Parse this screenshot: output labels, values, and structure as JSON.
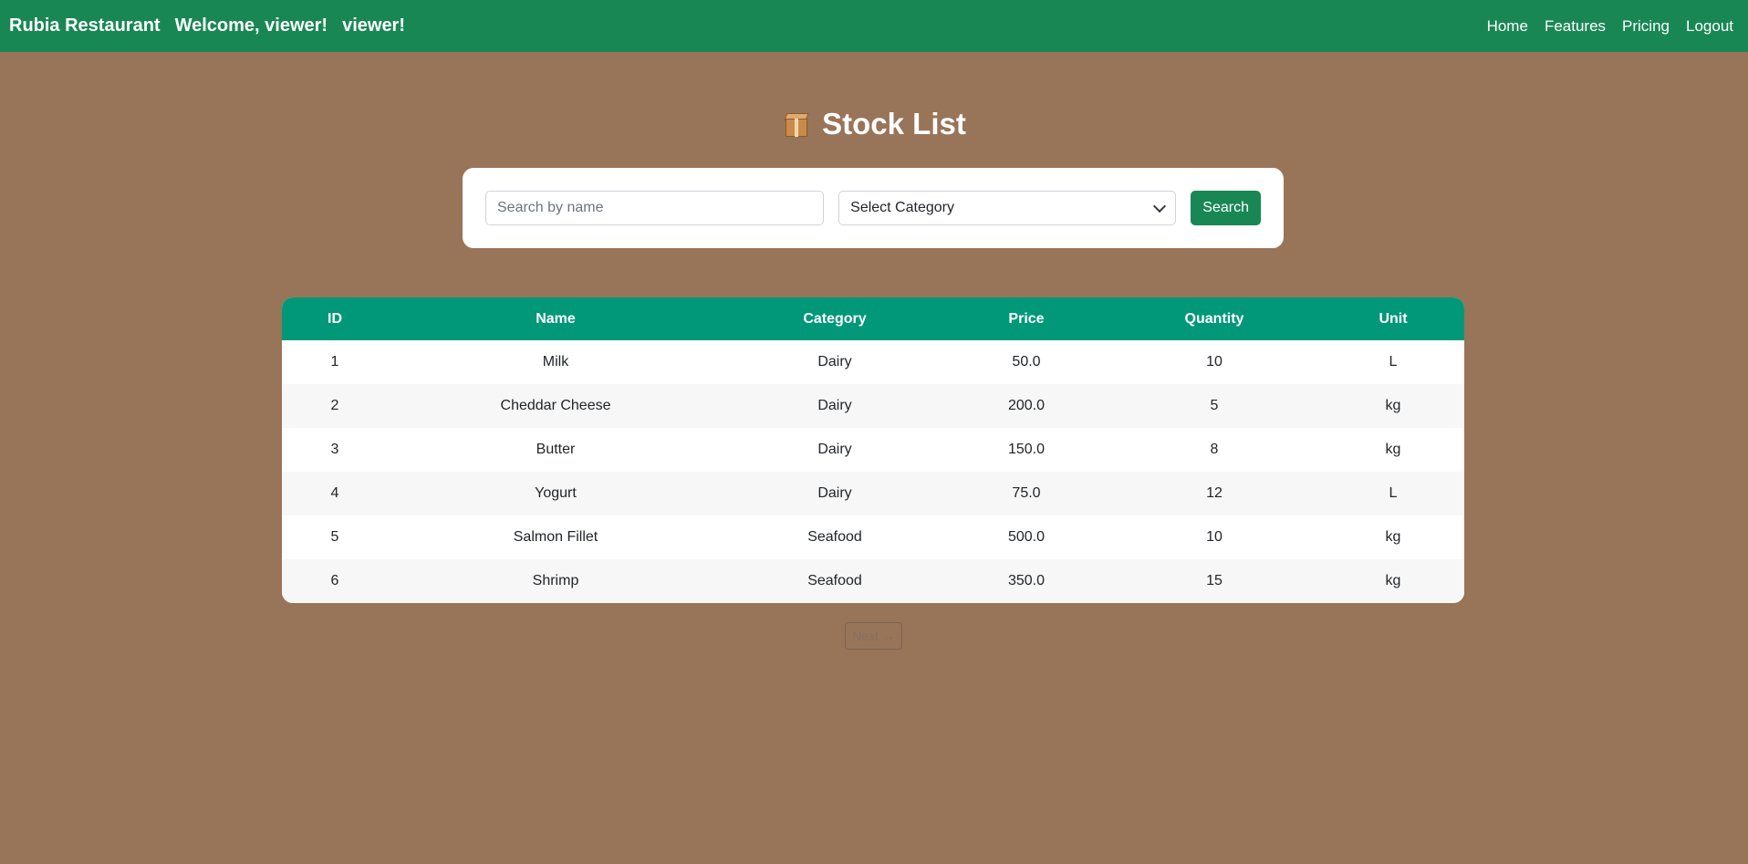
{
  "navbar": {
    "brand": "Rubia Restaurant",
    "welcome": "Welcome, viewer!",
    "username": "viewer!",
    "links": [
      "Home",
      "Features",
      "Pricing",
      "Logout"
    ],
    "bg_color": "#198754"
  },
  "page": {
    "title": "Stock List",
    "title_icon": "package-icon",
    "bg_color": "#987459"
  },
  "search": {
    "name_placeholder": "Search by name",
    "name_value": "",
    "category_selected": "Select Category",
    "button_label": "Search"
  },
  "table": {
    "header_color": "#009879",
    "columns": [
      "ID",
      "Name",
      "Category",
      "Price",
      "Quantity",
      "Unit"
    ],
    "rows": [
      [
        "1",
        "Milk",
        "Dairy",
        "50.0",
        "10",
        "L"
      ],
      [
        "2",
        "Cheddar Cheese",
        "Dairy",
        "200.0",
        "5",
        "kg"
      ],
      [
        "3",
        "Butter",
        "Dairy",
        "150.0",
        "8",
        "kg"
      ],
      [
        "4",
        "Yogurt",
        "Dairy",
        "75.0",
        "12",
        "L"
      ],
      [
        "5",
        "Salmon Fillet",
        "Seafood",
        "500.0",
        "10",
        "kg"
      ],
      [
        "6",
        "Shrimp",
        "Seafood",
        "350.0",
        "15",
        "kg"
      ]
    ]
  },
  "pagination": {
    "next_label": "Next →"
  }
}
